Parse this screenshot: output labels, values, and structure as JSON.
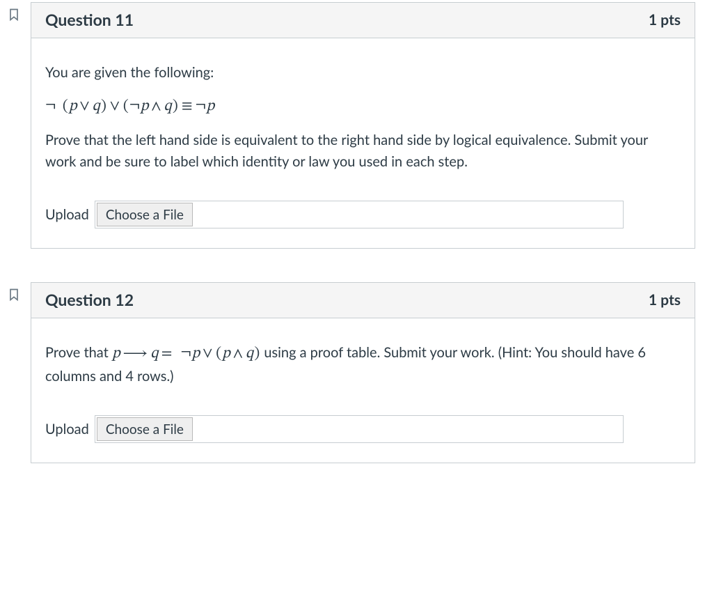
{
  "questions": [
    {
      "title": "Question 11",
      "points": "1 pts",
      "intro": "You are given the following:",
      "formula_html": "¬<span class='op'></span><span class='paren'>(</span><span class='it'>p</span><span class='op'>∨</span><span class='it'>q</span><span class='paren'>)</span><span class='op'>∨</span><span class='paren'>(</span>¬<span class='it'>p</span><span class='op'>∧</span><span class='it'>q</span><span class='paren'>)</span><span class='op'>≡</span>¬<span class='it'>p</span>",
      "instructions": "Prove that the left hand side is equivalent to the right hand side by logical equivalence. Submit your work and be sure to label which identity or law you used in each step.",
      "upload_label": "Upload",
      "choose_label": "Choose a File"
    },
    {
      "title": "Question 12",
      "points": "1 pts",
      "body_pre": "Prove that ",
      "formula_inline_html": "<span class='it'>p</span><span class='op'>⟶</span><span class='it'>q</span><span class='op'>=</span><span class='op'></span>¬<span class='it'>p</span><span class='op'>∨</span><span class='paren'>(</span><span class='it'>p</span><span class='op'>∧</span><span class='it'>q</span><span class='paren'>)</span>",
      "body_post": " using a proof table. Submit your work. (Hint: You should have 6 columns and 4 rows.)",
      "upload_label": "Upload",
      "choose_label": "Choose a File"
    }
  ]
}
